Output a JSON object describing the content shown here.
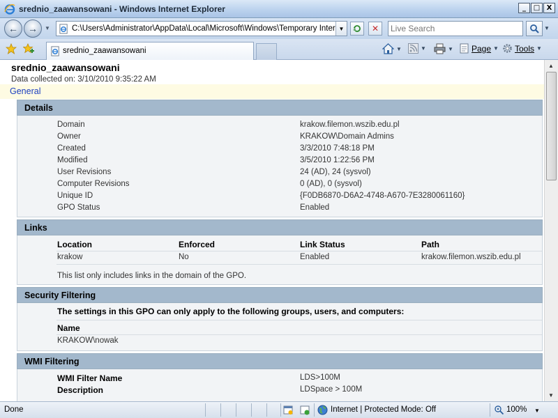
{
  "window": {
    "title": "srednio_zaawansowani - Windows Internet Explorer",
    "controls": {
      "minimize": "_",
      "maximize": "□",
      "close": "X"
    }
  },
  "nav": {
    "address_url": "C:\\Users\\Administrator\\AppData\\Local\\Microsoft\\Windows\\Temporary Interne",
    "search_placeholder": "Live Search"
  },
  "tabs": [
    {
      "label": "srednio_zaawansowani"
    }
  ],
  "commands": {
    "page": "Page",
    "tools": "Tools"
  },
  "report": {
    "title": "srednio_zaawansowani",
    "collected": "Data collected on: 3/10/2010 9:35:22 AM",
    "general_label": "General"
  },
  "details": {
    "heading": "Details",
    "rows": [
      {
        "label": "Domain",
        "value": "krakow.filemon.wszib.edu.pl"
      },
      {
        "label": "Owner",
        "value": "KRAKOW\\Domain Admins"
      },
      {
        "label": "Created",
        "value": "3/3/2010 7:48:18 PM"
      },
      {
        "label": "Modified",
        "value": "3/5/2010 1:22:56 PM"
      },
      {
        "label": "User Revisions",
        "value": "24 (AD), 24 (sysvol)"
      },
      {
        "label": "Computer Revisions",
        "value": "0 (AD), 0 (sysvol)"
      },
      {
        "label": "Unique ID",
        "value": "{F0DB6870-D6A2-4748-A670-7E3280061160}"
      },
      {
        "label": "GPO Status",
        "value": "Enabled"
      }
    ]
  },
  "links": {
    "heading": "Links",
    "columns": [
      "Location",
      "Enforced",
      "Link Status",
      "Path"
    ],
    "rows": [
      [
        "krakow",
        "No",
        "Enabled",
        "krakow.filemon.wszib.edu.pl"
      ]
    ],
    "note": "This list only includes links in the domain of the GPO."
  },
  "security": {
    "heading": "Security Filtering",
    "intro": "The settings in this GPO can only apply to the following groups, users, and computers:",
    "column": "Name",
    "rows": [
      "KRAKOW\\nowak"
    ]
  },
  "wmi": {
    "heading": "WMI Filtering",
    "rows": [
      {
        "label": "WMI Filter Name",
        "value": "LDS>100M"
      },
      {
        "label": "Description",
        "value": "LDSpace > 100M"
      }
    ]
  },
  "status": {
    "text": "Done",
    "zone": "Internet | Protected Mode: Off",
    "zoom": "100%"
  }
}
